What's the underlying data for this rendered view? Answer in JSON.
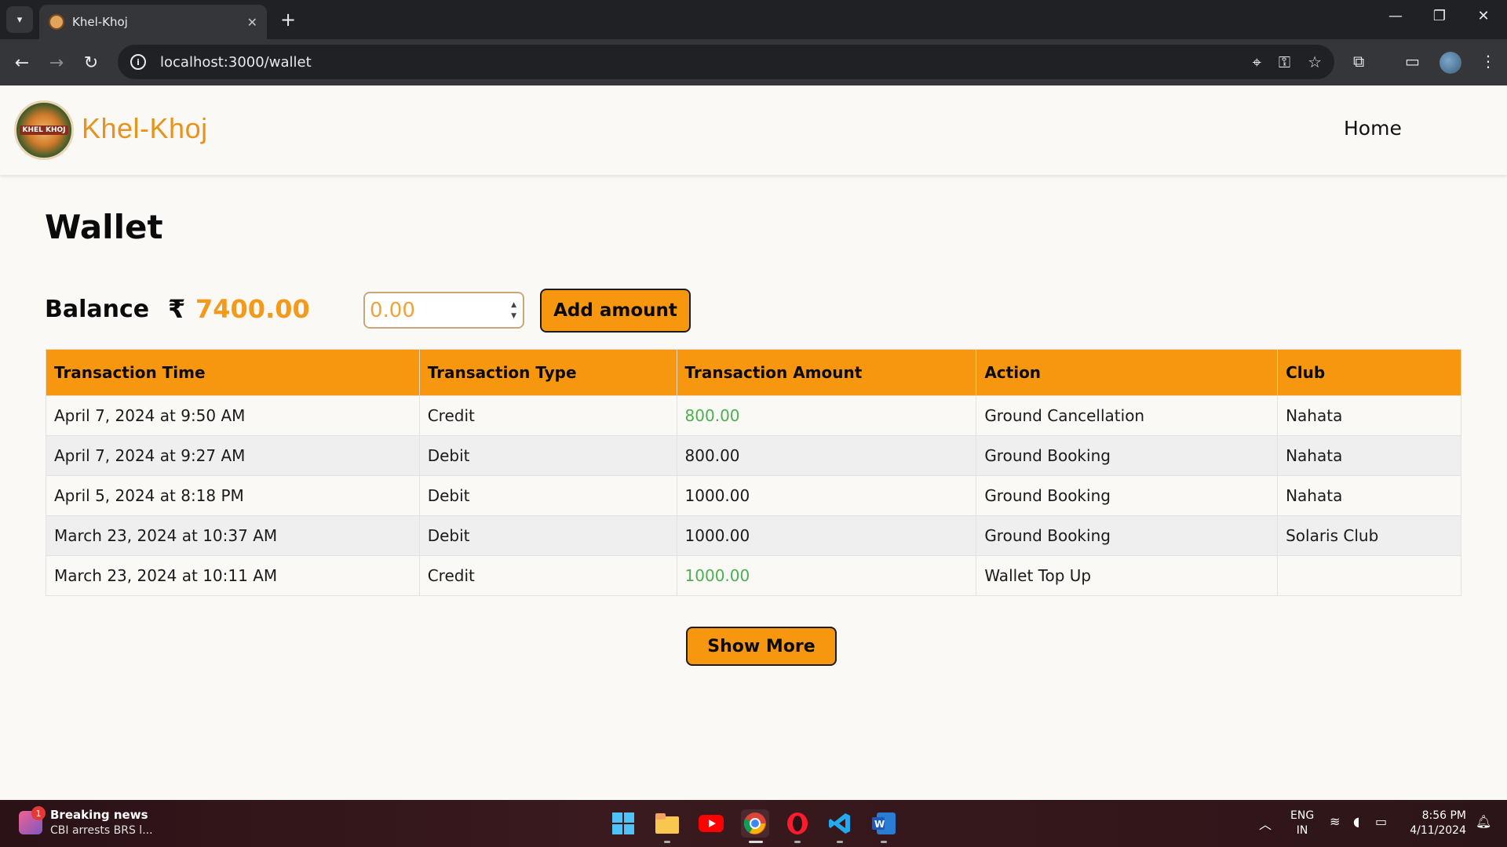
{
  "browser": {
    "tab_title": "Khel-Khoj",
    "tab_close": "✕",
    "new_tab": "+",
    "url": "localhost:3000/wallet"
  },
  "header": {
    "logo_text": "KHEL KHOJ",
    "brand": "Khel-Khoj",
    "nav_home": "Home"
  },
  "page": {
    "title": "Wallet",
    "balance_label": "Balance",
    "currency_symbol": "₹",
    "balance_value": "7400.00",
    "amount_placeholder": "0.00",
    "add_button": "Add amount",
    "show_more": "Show More"
  },
  "table": {
    "headers": [
      "Transaction Time",
      "Transaction Type",
      "Transaction Amount",
      "Action",
      "Club"
    ],
    "rows": [
      {
        "time": "April 7, 2024 at 9:50 AM",
        "type": "Credit",
        "amount": "800.00",
        "action": "Ground Cancellation",
        "club": "Nahata"
      },
      {
        "time": "April 7, 2024 at 9:27 AM",
        "type": "Debit",
        "amount": "800.00",
        "action": "Ground Booking",
        "club": "Nahata"
      },
      {
        "time": "April 5, 2024 at 8:18 PM",
        "type": "Debit",
        "amount": "1000.00",
        "action": "Ground Booking",
        "club": "Nahata"
      },
      {
        "time": "March 23, 2024 at 10:37 AM",
        "type": "Debit",
        "amount": "1000.00",
        "action": "Ground Booking",
        "club": "Solaris Club"
      },
      {
        "time": "March 23, 2024 at 10:11 AM",
        "type": "Credit",
        "amount": "1000.00",
        "action": "Wallet Top Up",
        "club": ""
      }
    ]
  },
  "taskbar": {
    "news_badge": "1",
    "news_title": "Breaking news",
    "news_subtitle": "CBI arrests BRS l...",
    "lang_line1": "ENG",
    "lang_line2": "IN",
    "time": "8:56 PM",
    "date": "4/11/2024"
  },
  "colors": {
    "accent": "#f7960f",
    "brand": "#e8931c",
    "credit": "#4caf50"
  }
}
